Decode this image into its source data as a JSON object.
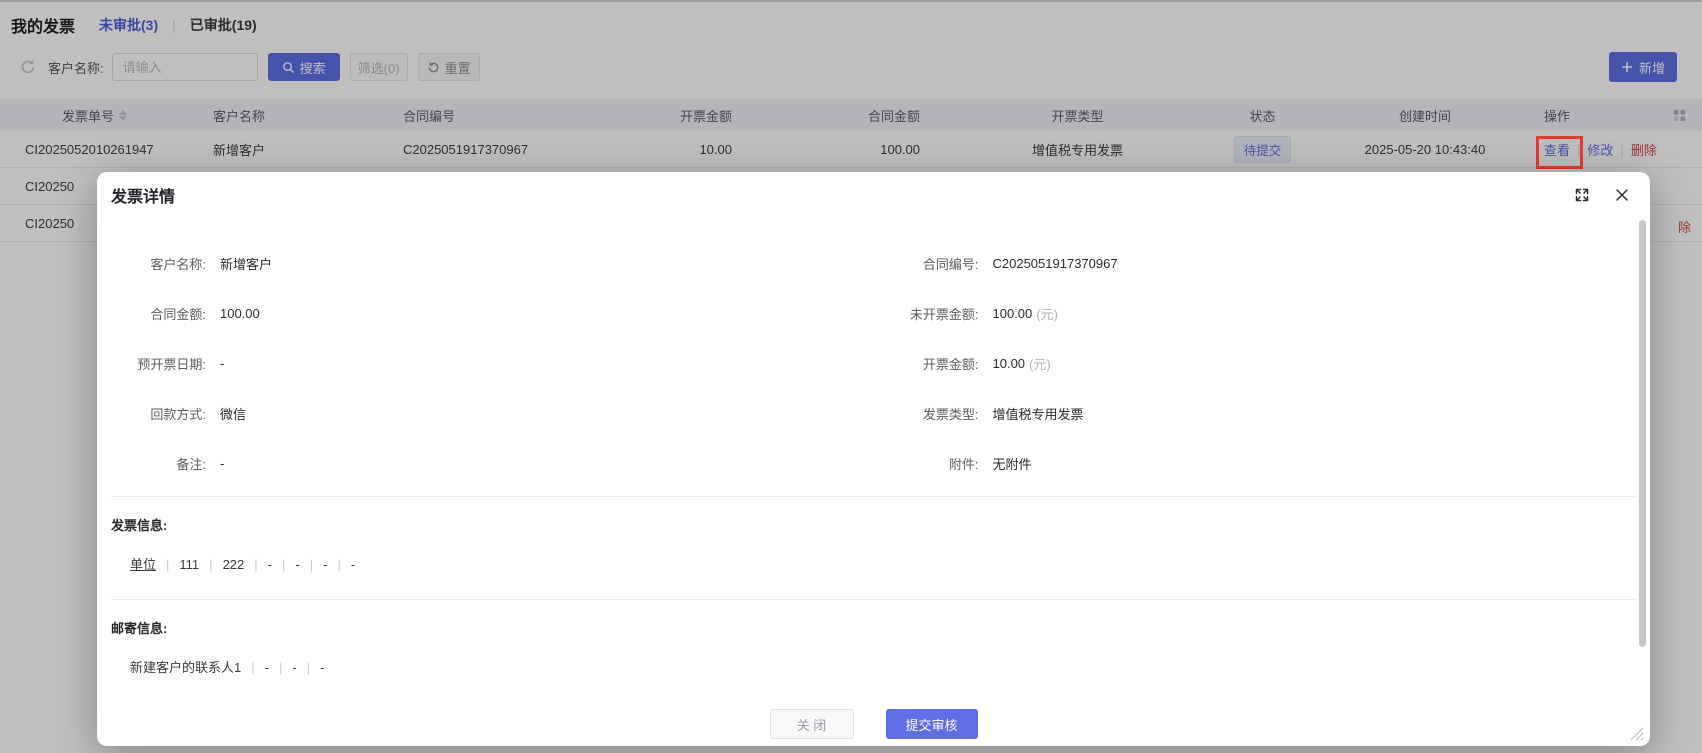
{
  "header": {
    "title": "我的发票",
    "tabs": [
      {
        "label": "未审批(3)"
      },
      {
        "label": "已审批(19)"
      }
    ],
    "tab_divider": "|"
  },
  "toolbar": {
    "customer_label": "客户名称:",
    "placeholder": "请输入",
    "search": "搜索",
    "filter": "筛选(0)",
    "reset": "重置",
    "add": "新增"
  },
  "table": {
    "headers": [
      "发票单号",
      "客户名称",
      "合同编号",
      "开票金额",
      "合同金额",
      "开票类型",
      "状态",
      "创建时间",
      "操作"
    ],
    "row1": {
      "invoice_no": "CI2025052010261947",
      "customer": "新增客户",
      "contract_no": "C2025051917370967",
      "invoice_amount": "10.00",
      "contract_amount": "100.00",
      "invoice_type": "增值税专用发票",
      "status": "待提交",
      "created_at": "2025-05-20 10:43:40",
      "action_view": "查看",
      "action_edit": "修改",
      "action_delete": "删除"
    },
    "row2_partial": "CI20250",
    "row3_partial": "CI20250",
    "row3_action_fragment": "除",
    "action_separator": "|"
  },
  "modal": {
    "title": "发票详情",
    "field_rows": [
      {
        "left": {
          "label": "客户名称:",
          "value": "新增客户"
        },
        "right": {
          "label": "合同编号:",
          "value": "C2025051917370967"
        }
      },
      {
        "left": {
          "label": "合同金额:",
          "value": "100.00"
        },
        "right": {
          "label": "未开票金额:",
          "value": "100.00",
          "suffix": "(元)"
        }
      },
      {
        "left": {
          "label": "预开票日期:",
          "value": "-"
        },
        "right": {
          "label": "开票金额:",
          "value": "10.00",
          "suffix": "(元)"
        }
      },
      {
        "left": {
          "label": "回款方式:",
          "value": "微信"
        },
        "right": {
          "label": "发票类型:",
          "value": "增值税专用发票"
        }
      },
      {
        "left": {
          "label": "备注:",
          "value": "-"
        },
        "right": {
          "label": "附件:",
          "value": "无附件"
        }
      }
    ],
    "invoice_info": {
      "title": "发票信息:",
      "items": [
        "单位",
        "111",
        "222",
        "-",
        "-",
        "-",
        "-"
      ]
    },
    "mail_info": {
      "title": "邮寄信息:",
      "items": [
        "新建客户的联系人1",
        "-",
        "-",
        "-"
      ]
    },
    "footer": {
      "close": "关 闭",
      "submit": "提交审核"
    }
  },
  "colors": {
    "primary": "#5f6ee4",
    "danger": "#cf4a43",
    "annotation_red": "#e23b2e",
    "status_badge_bg": "#edf0fc",
    "status_badge_text": "#6070e4",
    "table_header_bg": "#f1f2f6"
  }
}
